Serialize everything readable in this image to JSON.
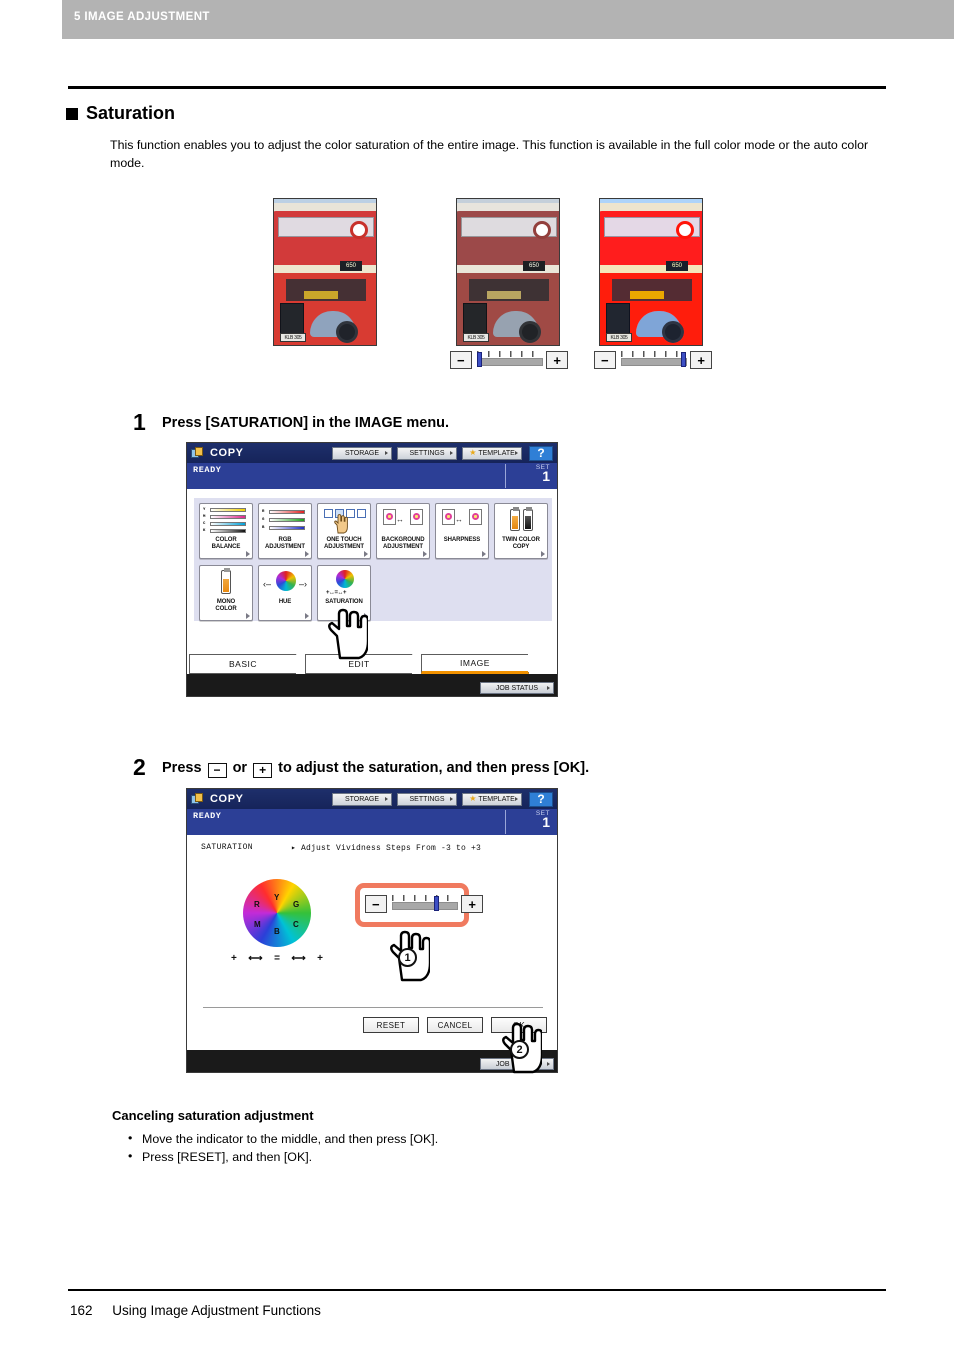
{
  "header": {
    "chapter": "5 IMAGE ADJUSTMENT"
  },
  "section": {
    "title": "Saturation",
    "intro": "This function enables you to adjust the color saturation of the entire image. This function is available in the full color mode or the auto color mode."
  },
  "samples": {
    "low_slider": {
      "minus": "−",
      "plus": "+",
      "position_label": "low"
    },
    "high_slider": {
      "minus": "−",
      "plus": "+",
      "position_label": "high"
    }
  },
  "steps": [
    {
      "number": "1",
      "text_before": "Press [SATURATION] in the IMAGE menu.",
      "text_mid": "",
      "text_after": ""
    },
    {
      "number": "2",
      "text_before": "Press",
      "key_minus": "−",
      "text_mid": "or",
      "key_plus": "+",
      "text_after": "to adjust the saturation, and then press [OK]."
    }
  ],
  "panel": {
    "app_title": "COPY",
    "toolbar": [
      {
        "label": "STORAGE"
      },
      {
        "label": "SETTINGS"
      },
      {
        "label": "TEMPLATE"
      }
    ],
    "help_label": "?",
    "status": "READY",
    "set_label": "SET",
    "set_value": "1",
    "job_status": "JOB STATUS"
  },
  "screen1": {
    "functions_row1": [
      {
        "label": "COLOR\nBALANCE",
        "icon": "color-balance-icon"
      },
      {
        "label": "RGB\nADJUSTMENT",
        "icon": "rgb-adjustment-icon"
      },
      {
        "label": "ONE TOUCH\nADJUSTMENT",
        "icon": "one-touch-adjustment-icon"
      },
      {
        "label": "BACKGROUND\nADJUSTMENT",
        "icon": "background-adjustment-icon"
      },
      {
        "label": "SHARPNESS",
        "icon": "sharpness-icon"
      },
      {
        "label": "TWIN COLOR\nCOPY",
        "icon": "twin-color-copy-icon"
      }
    ],
    "functions_row2": [
      {
        "label": "MONO\nCOLOR",
        "icon": "mono-color-icon"
      },
      {
        "label": "HUE",
        "icon": "hue-icon"
      },
      {
        "label": "SATURATION",
        "icon": "saturation-icon"
      }
    ],
    "tabs": [
      {
        "label": "BASIC",
        "active": false
      },
      {
        "label": "EDIT",
        "active": false
      },
      {
        "label": "IMAGE",
        "active": true
      }
    ],
    "color_balance_labels": [
      "Y",
      "M",
      "C",
      "K"
    ],
    "rgb_labels": [
      "R",
      "G",
      "B"
    ]
  },
  "screen2": {
    "mode_label": "SATURATION",
    "description": "▸ Adjust Vividness Steps From -3 to +3",
    "wheel_labels": [
      "R",
      "Y",
      "G",
      "M",
      "B",
      "C"
    ],
    "wheel_scale": [
      "+",
      "⟷",
      "=",
      "⟷",
      "+"
    ],
    "slider": {
      "minus": "−",
      "plus": "+"
    },
    "buttons": [
      {
        "label": "RESET"
      },
      {
        "label": "CANCEL"
      },
      {
        "label": "OK"
      }
    ],
    "callouts": [
      "1",
      "2"
    ]
  },
  "canceling": {
    "heading": "Canceling saturation adjustment",
    "items": [
      "Move the indicator to the middle, and then press [OK].",
      "Press [RESET], and then [OK]."
    ]
  },
  "footer": {
    "page": "162",
    "title": "Using Image Adjustment Functions"
  }
}
